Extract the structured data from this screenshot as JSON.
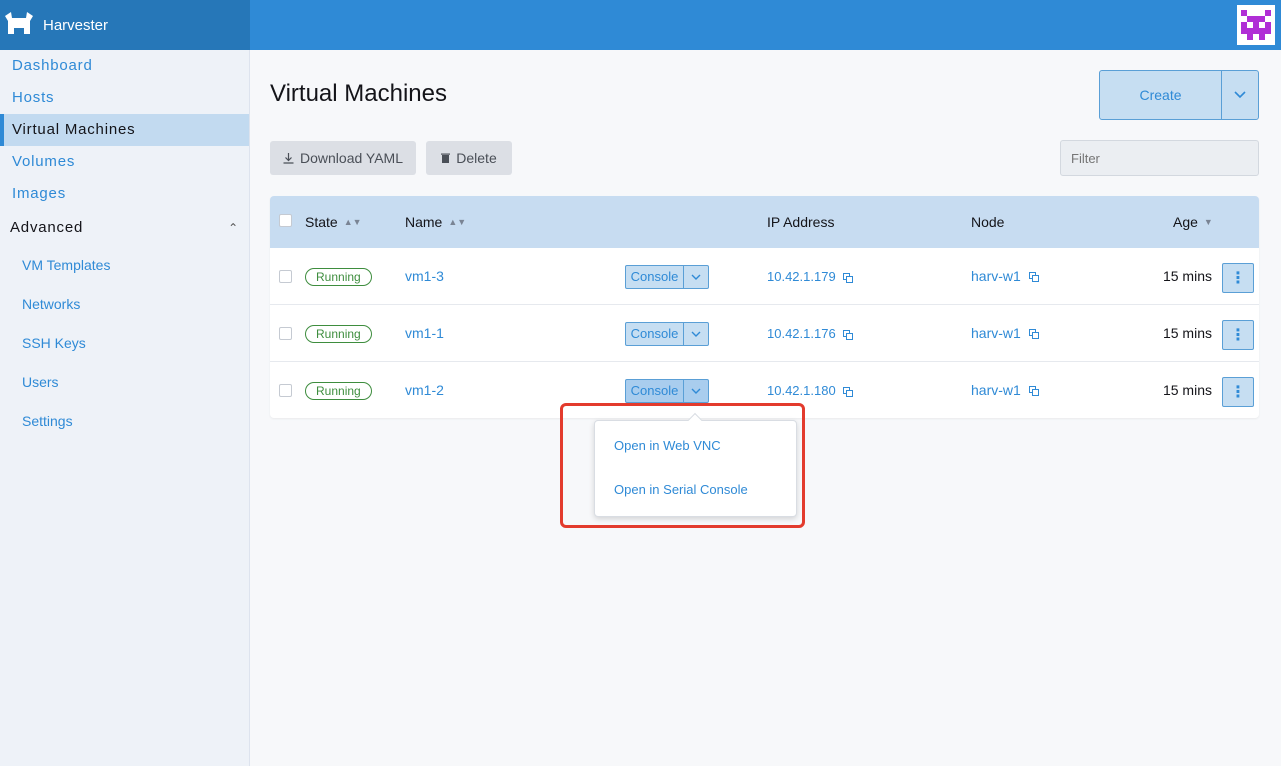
{
  "app": {
    "name": "Harvester"
  },
  "sidebar": {
    "items": [
      {
        "label": "Dashboard"
      },
      {
        "label": "Hosts"
      },
      {
        "label": "Virtual Machines"
      },
      {
        "label": "Volumes"
      },
      {
        "label": "Images"
      }
    ],
    "group": {
      "label": "Advanced"
    },
    "sub_items": [
      {
        "label": "VM Templates"
      },
      {
        "label": "Networks"
      },
      {
        "label": "SSH Keys"
      },
      {
        "label": "Users"
      },
      {
        "label": "Settings"
      }
    ]
  },
  "main": {
    "title": "Virtual Machines",
    "create_label": "Create",
    "download_label": "Download YAML",
    "delete_label": "Delete",
    "filter_placeholder": "Filter"
  },
  "table": {
    "headers": {
      "state": "State",
      "name": "Name",
      "ip": "IP Address",
      "node": "Node",
      "age": "Age"
    },
    "rows": [
      {
        "state": "Running",
        "name": "vm1-3",
        "console": "Console",
        "ip": "10.42.1.179",
        "node": "harv-w1",
        "age": "15 mins"
      },
      {
        "state": "Running",
        "name": "vm1-1",
        "console": "Console",
        "ip": "10.42.1.176",
        "node": "harv-w1",
        "age": "15 mins"
      },
      {
        "state": "Running",
        "name": "vm1-2",
        "console": "Console",
        "ip": "10.42.1.180",
        "node": "harv-w1",
        "age": "15 mins"
      }
    ]
  },
  "console_menu": {
    "items": [
      {
        "label": "Open in Web VNC"
      },
      {
        "label": "Open in Serial Console"
      }
    ]
  },
  "colors": {
    "accent": "#2f8ad6",
    "header": "#2f8ad6",
    "running": "#3e8d3e",
    "highlight": "#e33b2d"
  }
}
